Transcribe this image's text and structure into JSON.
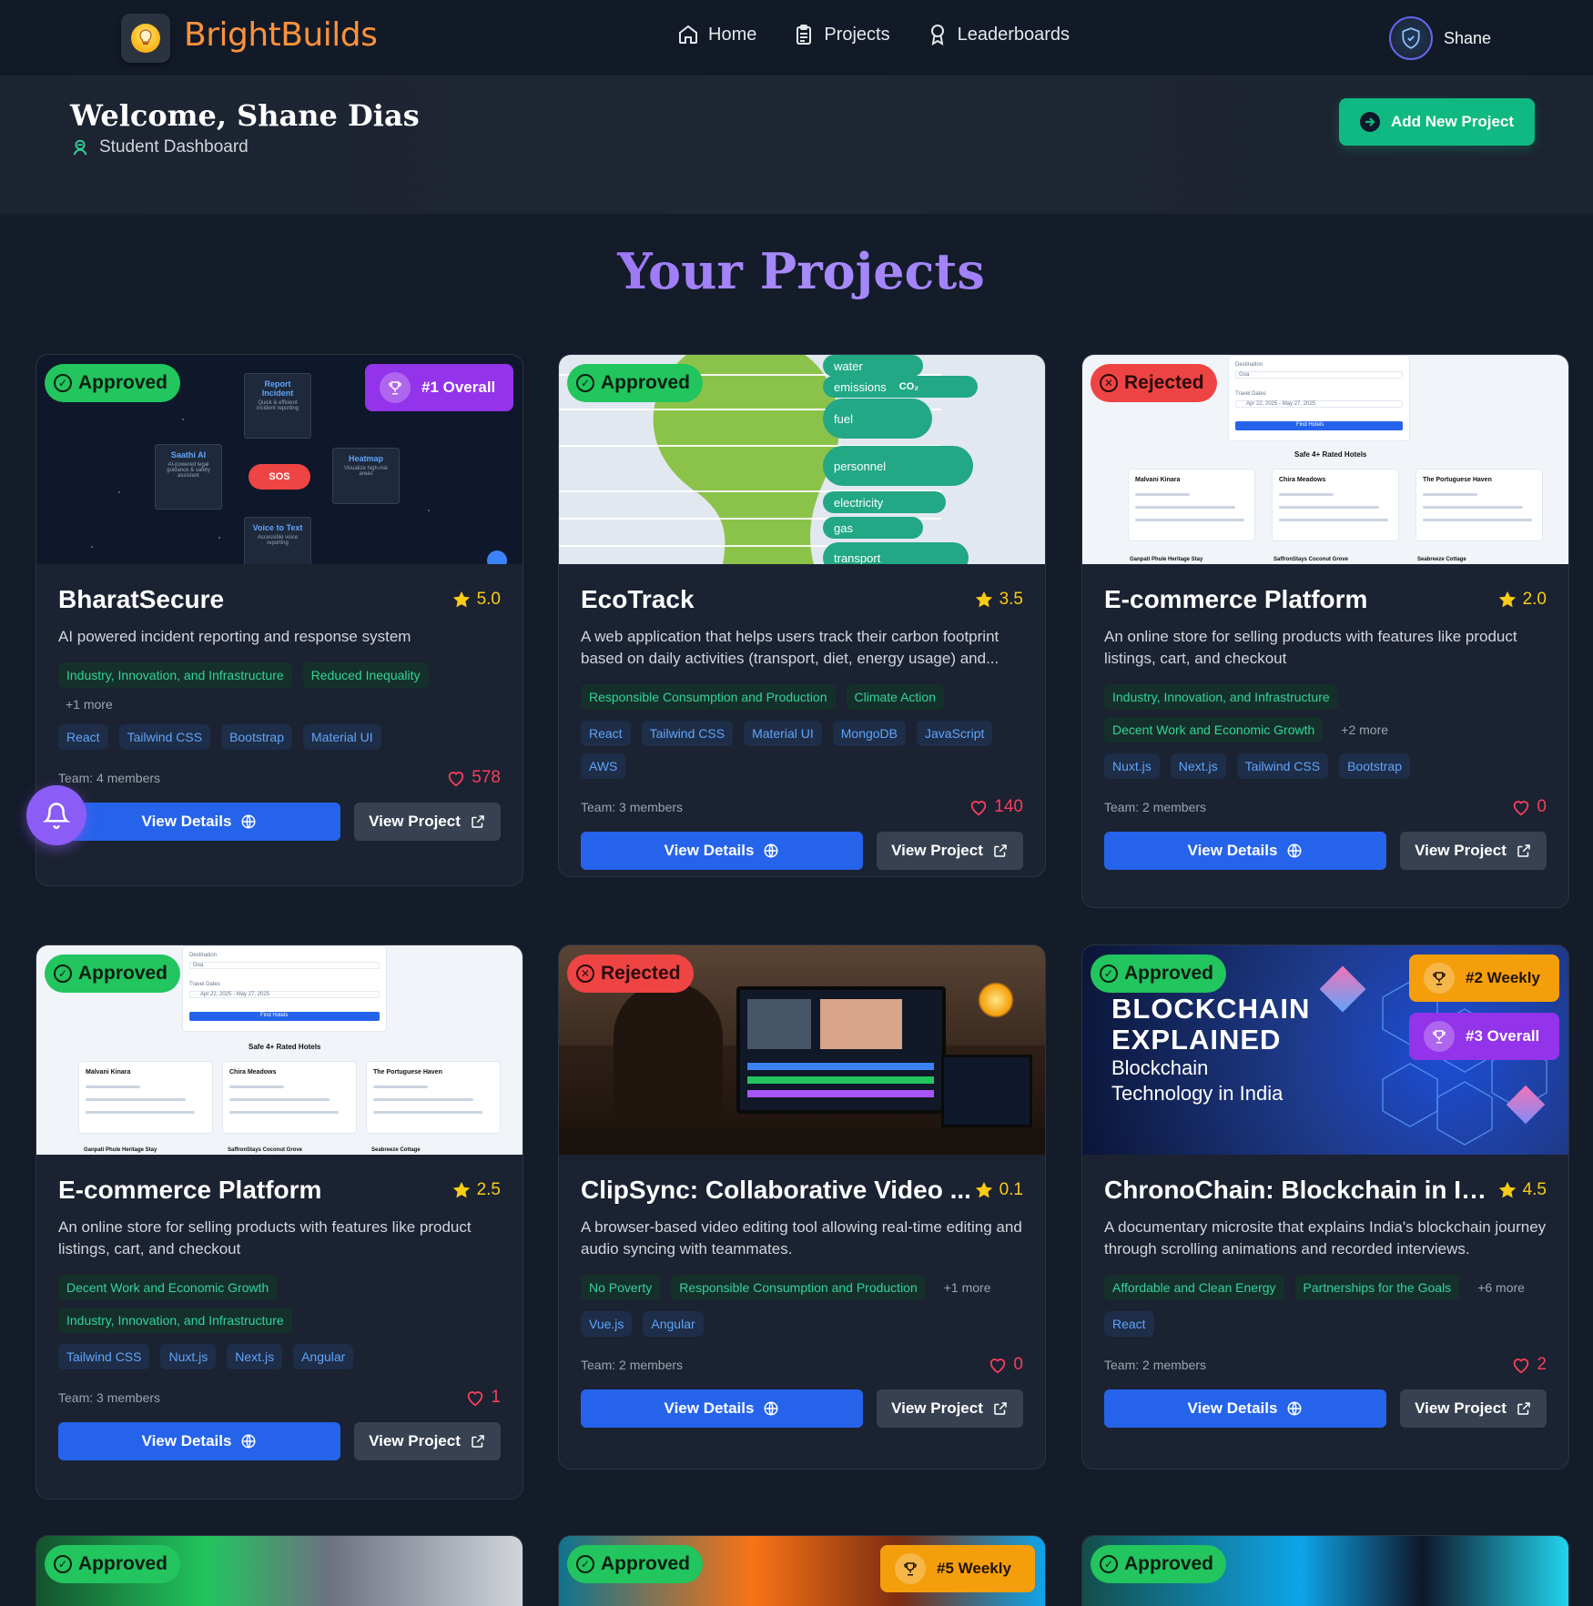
{
  "nav": {
    "brand": "BrightBuilds",
    "home": "Home",
    "projects": "Projects",
    "leaderboards": "Leaderboards",
    "user": "Shane"
  },
  "header": {
    "welcome": "Welcome, Shane Dias",
    "subtitle": "Student Dashboard",
    "add_button": "Add New Project"
  },
  "section_title": "Your Projects",
  "cards": [
    {
      "status": "Approved",
      "rank": "#1 Overall",
      "title": "BharatSecure",
      "rating": "5.0",
      "desc": "AI powered incident reporting and response system",
      "sdg": [
        "Industry, Innovation, and Infrastructure",
        "Reduced Inequality"
      ],
      "sdg_more": "+1 more",
      "tech": [
        "React",
        "Tailwind CSS",
        "Bootstrap",
        "Material UI"
      ],
      "team": "Team: 4 members",
      "likes": "578",
      "thumb": {
        "report": "Report Incident",
        "report_sub": "Quick & efficient incident reporting",
        "saathi": "Saathi AI",
        "saathi_sub": "AI-powered legal guidance & safety assistant",
        "sos": "SOS",
        "heatmap": "Heatmap",
        "heatmap_sub": "Visualize high-risk areas",
        "voice": "Voice to Text",
        "voice_sub": "Accessible voice reporting"
      }
    },
    {
      "status": "Approved",
      "title": "EcoTrack",
      "rating": "3.5",
      "desc": "A web application that helps users track their carbon footprint based on daily activities (transport, diet, energy usage) and...",
      "sdg": [
        "Responsible Consumption and Production",
        "Climate Action"
      ],
      "tech": [
        "React",
        "Tailwind CSS",
        "Material UI",
        "MongoDB",
        "JavaScript",
        "AWS"
      ],
      "team": "Team: 3 members",
      "likes": "140",
      "thumb": {
        "water": "water",
        "emissions": "emissions",
        "co2": "CO₂",
        "fuel": "fuel",
        "personnel": "personnel",
        "electricity": "electricity",
        "gas": "gas",
        "transport": "transport"
      }
    },
    {
      "status": "Rejected",
      "title": "E-commerce Platform",
      "rating": "2.0",
      "desc": "An online store for selling products with features like product listings, cart, and checkout",
      "sdg": [
        "Industry, Innovation, and Infrastructure",
        "Decent Work and Economic Growth"
      ],
      "sdg_more": "+2 more",
      "tech": [
        "Nuxt.js",
        "Next.js",
        "Tailwind CSS",
        "Bootstrap"
      ],
      "team": "Team: 2 members",
      "likes": "0"
    },
    {
      "status": "Approved",
      "title": "E-commerce Platform",
      "rating": "2.5",
      "desc": "An online store for selling products with features like product listings, cart, and checkout",
      "sdg": [
        "Decent Work and Economic Growth",
        "Industry, Innovation, and Infrastructure"
      ],
      "tech": [
        "Tailwind CSS",
        "Nuxt.js",
        "Next.js",
        "Angular"
      ],
      "team": "Team: 3 members",
      "likes": "1"
    },
    {
      "status": "Rejected",
      "title": "ClipSync: Collaborative Video ...",
      "rating": "0.1",
      "desc": "A browser-based video editing tool allowing real-time editing and audio syncing with teammates.",
      "sdg": [
        "No Poverty",
        "Responsible Consumption and Production"
      ],
      "sdg_more": "+1 more",
      "tech": [
        "Vue.js",
        "Angular"
      ],
      "team": "Team: 2 members",
      "likes": "0"
    },
    {
      "status": "Approved",
      "rank": "#2 Weekly",
      "rank2": "#3 Overall",
      "title": "ChronoChain: Blockchain in In...",
      "rating": "4.5",
      "desc": "A documentary microsite that explains India's blockchain journey through scrolling animations and recorded interviews.",
      "sdg": [
        "Affordable and Clean Energy",
        "Partnerships for the Goals"
      ],
      "sdg_more": "+6 more",
      "tech": [
        "React"
      ],
      "team": "Team: 2 members",
      "likes": "2",
      "thumb": {
        "line1": "BLOCKCHAIN",
        "line2": "EXPLAINED",
        "line3": "Blockchain",
        "line4": "Technology in India"
      }
    }
  ],
  "bottom_cards": [
    {
      "status": "Approved"
    },
    {
      "status": "Approved",
      "rank": "#5 Weekly"
    },
    {
      "status": "Approved"
    }
  ],
  "hotel_thumb": {
    "destination": "Destination",
    "dest_value": "Goa",
    "travel_dates": "Travel Dates",
    "date_value": "Apr 22, 2025 - May 27, 2025",
    "find": "Find Hotels",
    "heading": "Safe 4+ Rated Hotels",
    "h1": "Malvani Kinara",
    "h2": "Chira Meadows",
    "h3": "The Portuguese Haven",
    "h4": "Ganpati Phule Heritage Stay",
    "h5": "SaffronStays Coconut Grove",
    "h6": "Seabreeze Cottage"
  },
  "buttons": {
    "view_details": "View Details",
    "view_project": "View Project"
  }
}
